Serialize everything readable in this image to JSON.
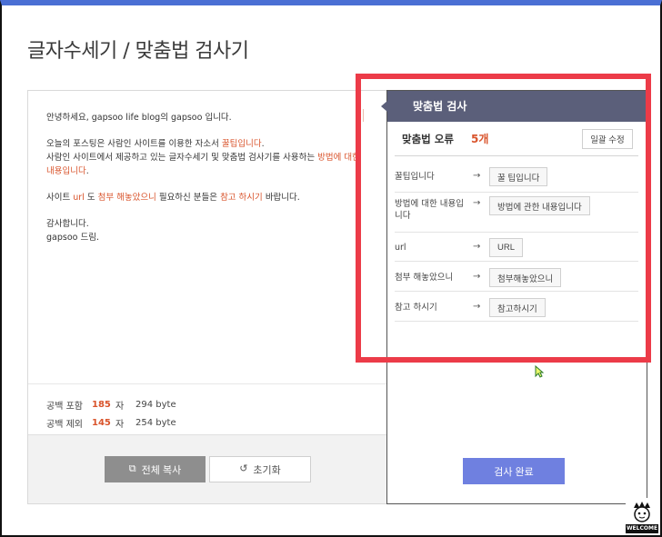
{
  "app": {
    "title": "글자수세기 / 맞춤법 검사기"
  },
  "editor": {
    "para1": [
      {
        "t": "안녕하세요, gapsoo life blog의 gapsoo 입니다.",
        "hl": false
      }
    ],
    "para2": [
      {
        "t": "오늘의 포스팅은 사람인 사이트를 이용한 자소서 ",
        "hl": false
      },
      {
        "t": "꿀팁입니다",
        "hl": true
      },
      {
        "t": ".",
        "hl": false
      },
      {
        "t": "사람인 사이트에서 제공하고 있는 글자수세기 및 맞춤법 검사기를 사용하는 ",
        "hl": false,
        "br": true
      },
      {
        "t": "방법에 대한 내용입니다",
        "hl": true
      },
      {
        "t": ".",
        "hl": false
      }
    ],
    "para3": [
      {
        "t": "사이트 ",
        "hl": false
      },
      {
        "t": "url",
        "hl": true
      },
      {
        "t": " 도 ",
        "hl": false
      },
      {
        "t": "첨부 해놓았으니",
        "hl": true
      },
      {
        "t": " 필요하신 분들은 ",
        "hl": false
      },
      {
        "t": "참고 하시기",
        "hl": true
      },
      {
        "t": " 바랍니다.",
        "hl": false
      }
    ],
    "para4": [
      {
        "t": "감사합니다.",
        "hl": false
      },
      {
        "t": "gapsoo 드림.",
        "hl": false,
        "br": true
      }
    ]
  },
  "counts": {
    "with_space": {
      "label": "공백 포함",
      "chars": "185",
      "unit": "자",
      "bytes": "294 byte"
    },
    "without_space": {
      "label": "공백 제외",
      "chars": "145",
      "unit": "자",
      "bytes": "254 byte"
    }
  },
  "actions": {
    "copy_label": "전체 복사",
    "reset_label": "초기화"
  },
  "results": {
    "title": "맞춤법 검사",
    "error_label": "맞춤법 오류",
    "error_count": "5개",
    "fix_all_label": "일괄 수정",
    "arrow": "→",
    "suggestions": [
      {
        "original": "꿀팁입니다",
        "fix": "꿀 팁입니다"
      },
      {
        "original": "방법에 대한 내용입니다",
        "fix": "방법에 관한 내용입니다"
      },
      {
        "original": "url",
        "fix": "URL"
      },
      {
        "original": "첨부 해놓았으니",
        "fix": "첨부해놓았으니"
      },
      {
        "original": "참고 하시기",
        "fix": "참고하시기"
      }
    ],
    "done_label": "검사 완료"
  },
  "mascot": {
    "caption": "WELCOME"
  },
  "colors": {
    "accent_red": "#d9542c",
    "header_bg": "#5b5f7a",
    "done_btn": "#6f80e0",
    "highlight_box": "#ec3b48",
    "top_bar": "#4a6fd4"
  }
}
